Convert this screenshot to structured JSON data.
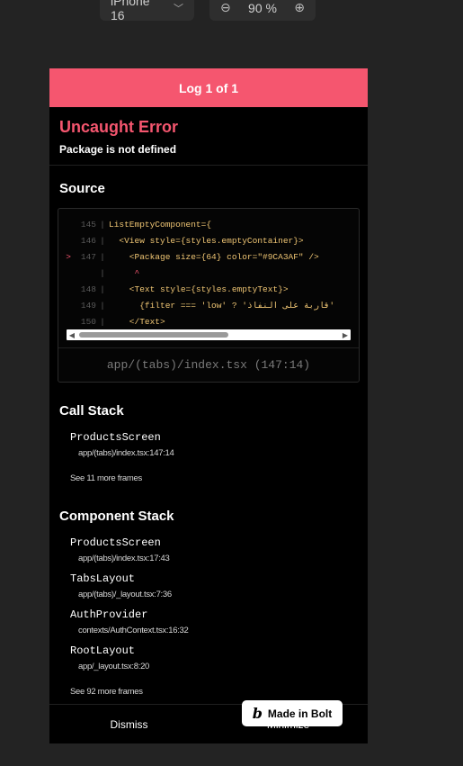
{
  "toolbar": {
    "device": "iPhone 16",
    "zoom": "90 %"
  },
  "log_header": "Log 1 of 1",
  "error": {
    "title": "Uncaught Error",
    "message": "Package is not defined"
  },
  "source": {
    "title": "Source",
    "lines": [
      {
        "marker": "",
        "num": "145",
        "code": "ListEmptyComponent={"
      },
      {
        "marker": "",
        "num": "146",
        "code": "  <View style={styles.emptyContainer}>"
      },
      {
        "marker": ">",
        "num": "147",
        "code": "    <Package size={64} color=\"#9CA3AF\" />"
      },
      {
        "marker": "",
        "num": "",
        "code": "     ^"
      },
      {
        "marker": "",
        "num": "148",
        "code": "    <Text style={styles.emptyText}>"
      },
      {
        "marker": "",
        "num": "149",
        "code": "      {filter === 'low' ? 'قاربة على النفاذ'"
      },
      {
        "marker": "",
        "num": "150",
        "code": "    </Text>"
      }
    ],
    "file_ref": "app/(tabs)/index.tsx (147:14)"
  },
  "call_stack": {
    "title": "Call Stack",
    "frames": [
      {
        "name": "ProductsScreen",
        "loc": "app/(tabs)/index.tsx:147:14"
      }
    ],
    "see_more": "See 11 more frames"
  },
  "component_stack": {
    "title": "Component Stack",
    "frames": [
      {
        "name": "ProductsScreen",
        "loc": "app/(tabs)/index.tsx:17:43"
      },
      {
        "name": "TabsLayout",
        "loc": "app/(tabs)/_layout.tsx:7:36"
      },
      {
        "name": "AuthProvider",
        "loc": "contexts/AuthContext.tsx:16:32"
      },
      {
        "name": "RootLayout",
        "loc": "app/_layout.tsx:8:20"
      }
    ],
    "see_more": "See 92 more frames"
  },
  "footer": {
    "dismiss": "Dismiss",
    "minimize": "Minimize"
  },
  "badge": {
    "logo": "b",
    "label": "Made in Bolt"
  },
  "colors": {
    "accent": "#f5566f",
    "background": "#000000",
    "code": "#f0c674"
  }
}
